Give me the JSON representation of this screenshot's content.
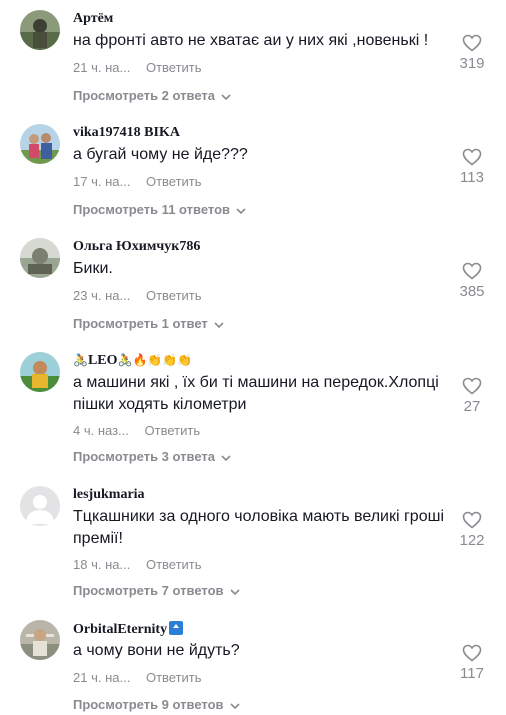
{
  "comments": [
    {
      "author": "Артём",
      "text": "на фронті авто не хватає аи у них які ,новенькі !",
      "time": "21 ч. на...",
      "reply_label": "Ответить",
      "replies_label": "Просмотреть 2 ответа",
      "likes": "319",
      "avatar_color": "#5a6b4a"
    },
    {
      "author": "vika197418 BIKA",
      "text": "а бугай чому не йде???",
      "time": "17 ч. на...",
      "reply_label": "Ответить",
      "replies_label": "Просмотреть 11 ответов",
      "likes": "113",
      "avatar_color": "#7aa6c9"
    },
    {
      "author": "Ольга Юхимчук786",
      "text": "Бики.",
      "time": "23 ч. на...",
      "reply_label": "Ответить",
      "replies_label": "Просмотреть 1 ответ",
      "likes": "385",
      "avatar_color": "#9aa592"
    },
    {
      "author_prefix": "🚴",
      "author": "LEO",
      "author_suffix": "🚴🔥👏👏👏",
      "text": "а машини які , їх би ті машини на передок.Хлопці пішки ходять кілометри",
      "time": "4 ч. наз...",
      "reply_label": "Ответить",
      "replies_label": "Просмотреть 3 ответа",
      "likes": "27",
      "avatar_color": "#e8b62c"
    },
    {
      "author": "lesjukmaria",
      "text": "Тцкашники за одного чоловіка мають великі гроші премії!",
      "time": "18 ч. на...",
      "reply_label": "Ответить",
      "replies_label": "Просмотреть 7 ответов",
      "likes": "122",
      "avatar_color": "#e3e3e6"
    },
    {
      "author": "OrbitalEternity",
      "badge": "top-badge-icon",
      "text": "а чому вони не йдуть?",
      "time": "21 ч. на...",
      "reply_label": "Ответить",
      "replies_label": "Просмотреть 9 ответов",
      "likes": "117",
      "avatar_color": "#8a8f7e"
    }
  ],
  "icons": {
    "like": "heart-outline-icon",
    "expand": "chevron-down-icon"
  }
}
